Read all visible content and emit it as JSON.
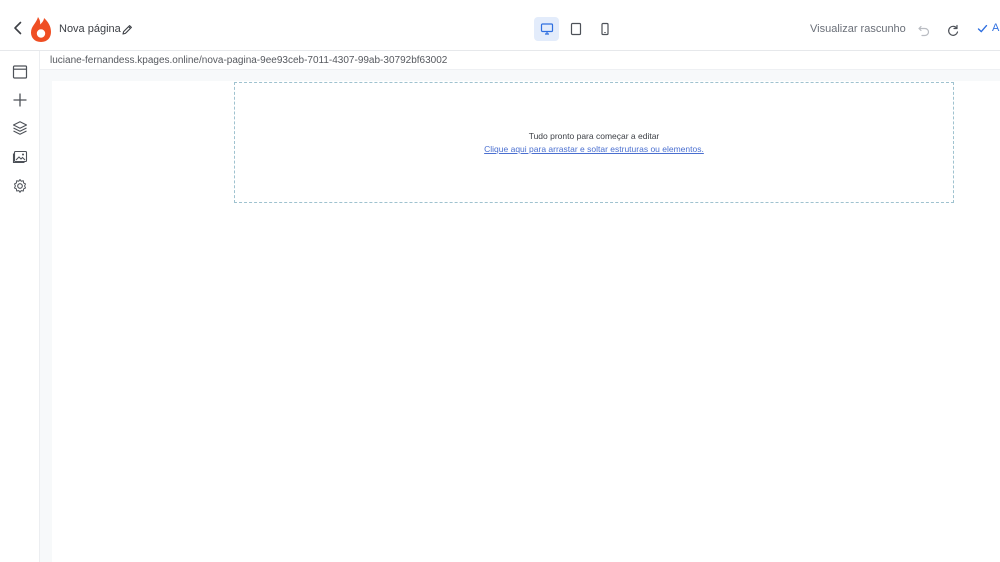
{
  "header": {
    "page_title": "Nova página",
    "preview_label": "Visualizar rascunho",
    "save_label": "A",
    "logo_color": "#ef4e23",
    "accent": "#2f6fe0",
    "icons": [
      "chevron-left-icon",
      "hotmart-logo",
      "pencil-icon",
      "desktop-icon",
      "tablet-icon",
      "mobile-icon",
      "undo-icon",
      "redo-icon",
      "check-icon"
    ]
  },
  "url_bar": {
    "url": "luciane-fernandess.kpages.online/nova-pagina-9ee93ceb-7011-4307-99ab-30792bf63002"
  },
  "sidebar": {
    "items": [
      {
        "icon": "window-icon"
      },
      {
        "icon": "plus-icon"
      },
      {
        "icon": "layers-icon"
      },
      {
        "icon": "image-gallery-icon"
      },
      {
        "icon": "gear-icon"
      }
    ]
  },
  "canvas": {
    "ready_text": "Tudo pronto para começar a editar",
    "drag_link": "Clique aqui para arrastar e soltar estruturas ou elementos."
  }
}
